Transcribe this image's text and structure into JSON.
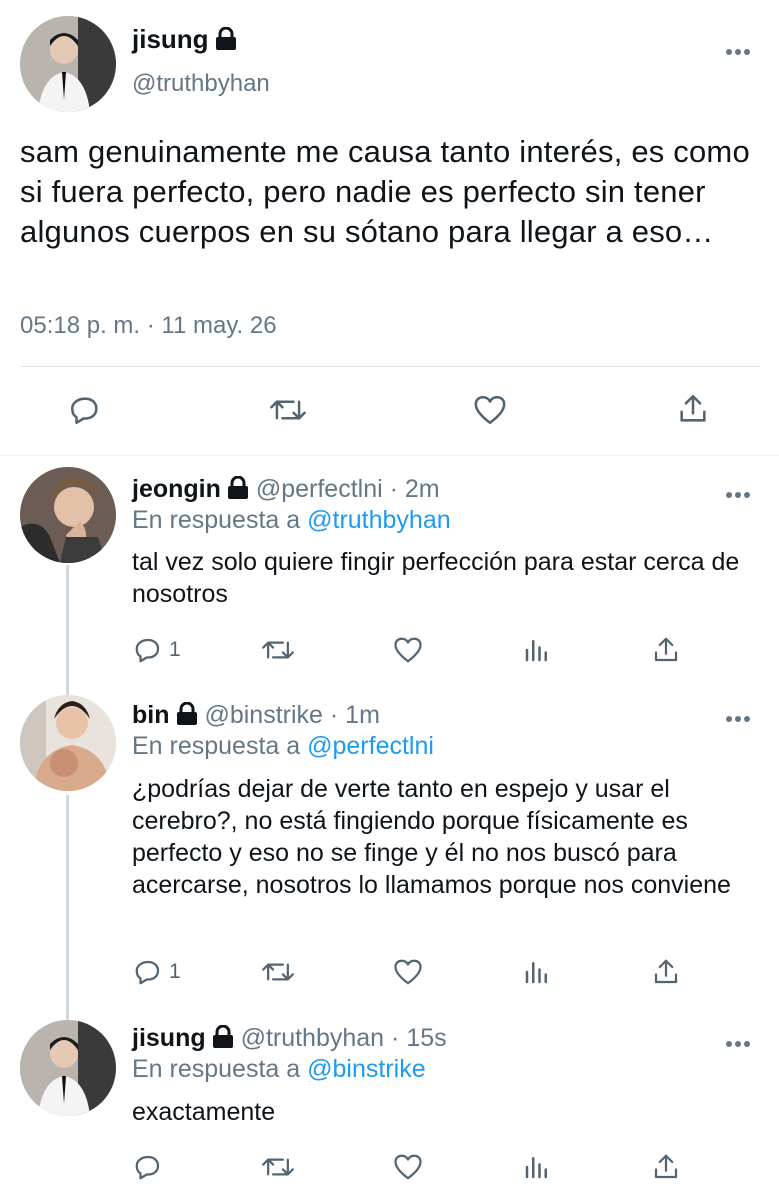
{
  "main_tweet": {
    "name": "jisung",
    "handle": "@truthbyhan",
    "text": "sam genuinamente me causa tanto interés, es como si fuera perfecto, pero nadie es perfecto sin tener algunos cuerpos en su sótano para llegar a eso…",
    "timestamp": "05:18 p. m. · 11 may. 26",
    "actions": [
      "reply-icon",
      "retweet-icon",
      "like-icon",
      "share-icon"
    ]
  },
  "replies": [
    {
      "name": "jeongin",
      "handle": "@perfectlni",
      "time": "· 2m",
      "reply_prefix": "En respuesta a",
      "reply_to": "@truthbyhan",
      "text": "tal vez solo quiere fingir perfección para estar cerca de nosotros",
      "reply_count": "1"
    },
    {
      "name": "bin",
      "handle": "@binstrike",
      "time": "· 1m",
      "reply_prefix": "En respuesta a",
      "reply_to": "@perfectlni",
      "text": "¿podrías dejar de verte tanto en espejo y usar el cerebro?, no está fingiendo porque físicamente es perfecto y eso no se finge y él no nos buscó para acercarse, nosotros lo llamamos porque nos conviene",
      "reply_count": "1"
    },
    {
      "name": "jisung",
      "handle": "@truthbyhan",
      "time": "· 15s",
      "reply_prefix": "En respuesta a",
      "reply_to": "@binstrike",
      "text": "exactamente",
      "reply_count": ""
    }
  ],
  "colors": {
    "link": "#1d9bf0",
    "muted": "#657786",
    "text": "#0f1419",
    "thread_line": "#cfd9de"
  }
}
